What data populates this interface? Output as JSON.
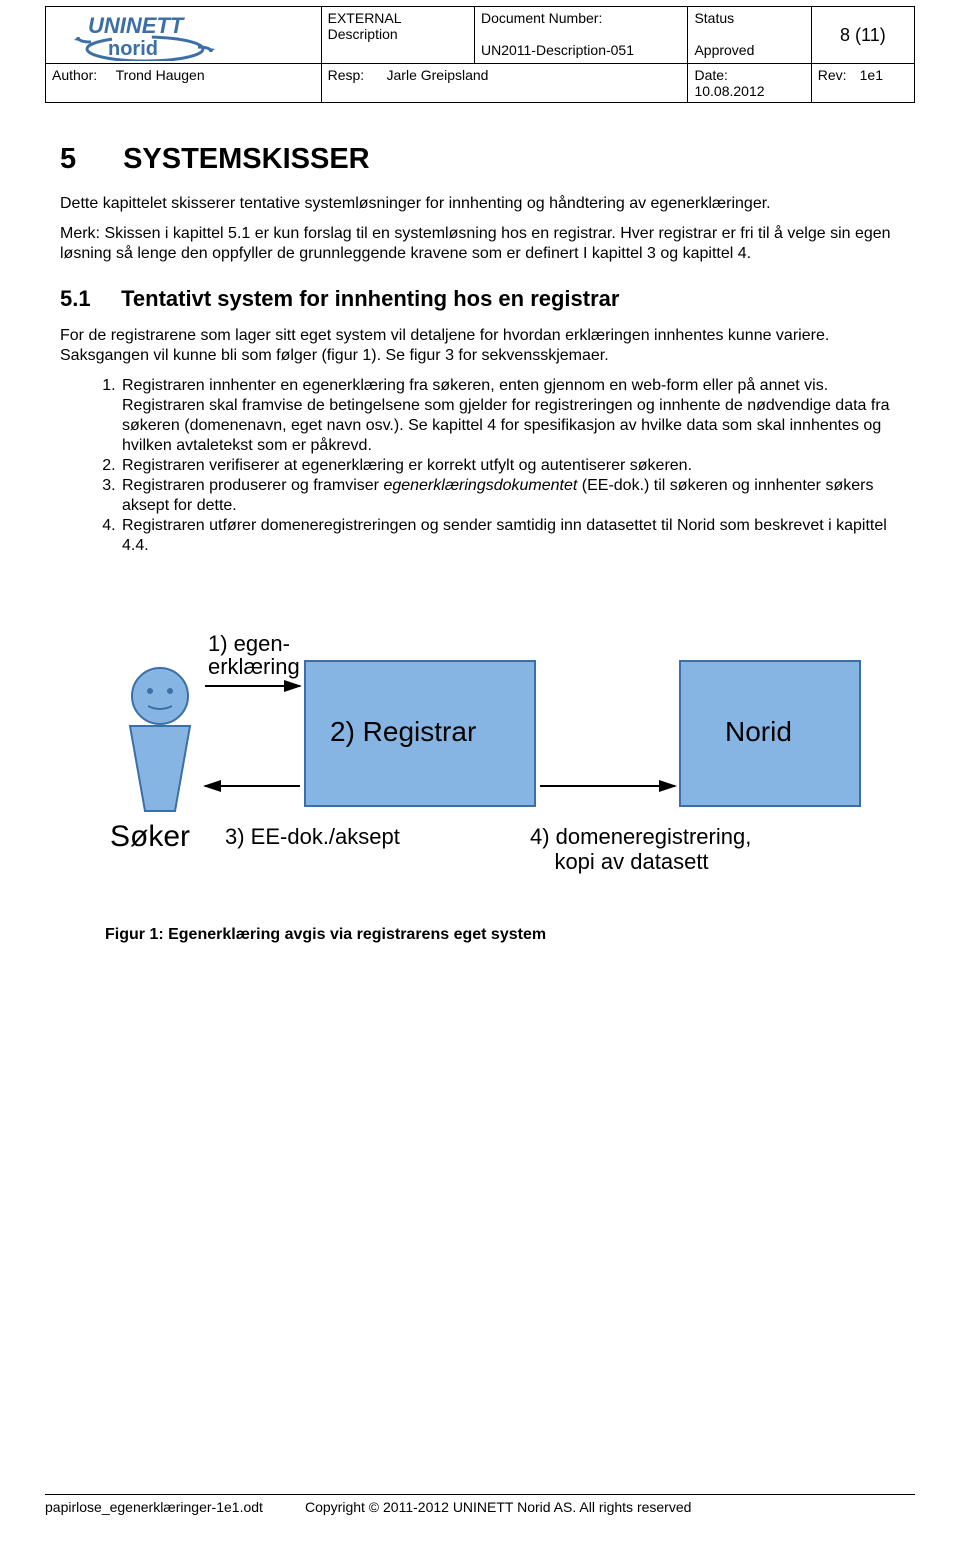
{
  "header": {
    "docType1": "EXTERNAL",
    "docType2": "Description",
    "docNumLabel": "Document Number:",
    "docNum": "UN2011-Description-051",
    "statusLabel": "Status",
    "status": "Approved",
    "pageNum": "8 (11)",
    "authorLabel": "Author:",
    "author": "Trond Haugen",
    "respLabel": "Resp:",
    "resp": "Jarle Greipsland",
    "dateLabel": "Date:",
    "date": "10.08.2012",
    "revLabel": "Rev:",
    "rev": "1e1"
  },
  "section": {
    "num": "5",
    "title": "SYSTEMSKISSER",
    "intro1": "Dette kapittelet skisserer tentative systemløsninger for innhenting og håndtering av egenerklæringer.",
    "intro2": "Merk: Skissen i kapittel  5.1 er kun forslag til en systemløsning hos en registrar. Hver registrar er fri til å velge sin egen løsning så lenge den oppfyller de grunnleggende kravene som er definert I kapittel 3 og kapittel 4."
  },
  "subsection": {
    "num": "5.1",
    "title": "Tentativt system for innhenting hos en registrar",
    "p1": "For de registrarene som lager sitt eget system vil detaljene for hvordan erklæringen innhentes kunne variere. Saksgangen vil kunne bli som følger (figur 1). Se figur 3 for sekvensskjemaer.",
    "li1a": "Registraren innhenter en egenerklæring fra søkeren, enten gjennom en web-form eller på annet vis. Registraren skal framvise de betingelsene som gjelder for registreringen og innhente de nødvendige data fra søkeren (domenenavn, eget navn osv.). Se  kapittel 4 for spesifikasjon av hvilke data som skal innhentes og hvilken avtaletekst som er påkrevd.",
    "li2": "Registraren verifiserer at egenerklæring er korrekt utfylt og autentiserer søkeren.",
    "li3a": "Registraren produserer og framviser ",
    "li3em": "egenerklæringsdokumentet",
    "li3b": " (EE-dok.) til søkeren og innhenter søkers aksept for dette.",
    "li4": "Registraren utfører domeneregistreringen og sender samtidig inn datasettet til Norid som beskrevet i kapittel 4.4."
  },
  "diagram": {
    "label1": "1) egen-\nerklæring",
    "boxRegistrar": "2) Registrar",
    "boxNorid": "Norid",
    "soker": "Søker",
    "label3": "3) EE-dok./aksept",
    "label4a": "4) domeneregistrering,",
    "label4b": "    kopi av datasett"
  },
  "figcaption": "Figur 1: Egenerklæring avgis via registrarens eget system",
  "footer": {
    "file": "papirlose_egenerklæringer-1e1.odt",
    "copyright": "Copyright © 2011-2012 UNINETT Norid AS. All rights reserved"
  }
}
